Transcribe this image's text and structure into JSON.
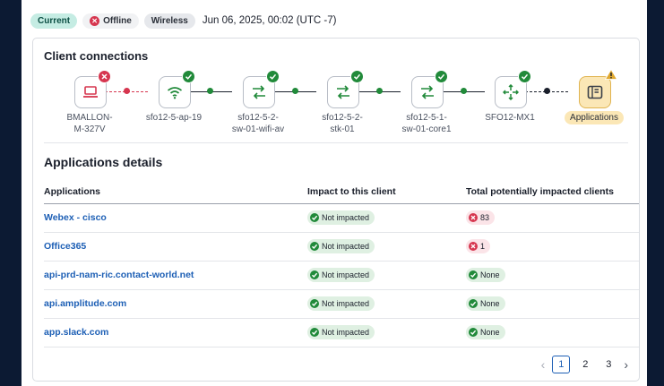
{
  "status": {
    "current_label": "Current",
    "offline_label": "Offline",
    "wireless_label": "Wireless",
    "timestamp": "Jun 06, 2025, 00:02 (UTC -7)"
  },
  "client_connections": {
    "title": "Client connections",
    "nodes": [
      {
        "label_line1": "BMALLON-",
        "label_line2": "M-327V",
        "icon": "laptop-icon",
        "status": "error"
      },
      {
        "label_line1": "sfo12-5-ap-19",
        "label_line2": "",
        "icon": "wifi-icon",
        "status": "ok"
      },
      {
        "label_line1": "sfo12-5-2-",
        "label_line2": "sw-01-wifi-av",
        "icon": "switch-icon",
        "status": "ok"
      },
      {
        "label_line1": "sfo12-5-2-",
        "label_line2": "stk-01",
        "icon": "switch-icon",
        "status": "ok"
      },
      {
        "label_line1": "sfo12-5-1-",
        "label_line2": "sw-01-core1",
        "icon": "switch-icon",
        "status": "ok"
      },
      {
        "label_line1": "SFO12-MX1",
        "label_line2": "",
        "icon": "router-icon",
        "status": "ok"
      },
      {
        "label_line1": "Applications",
        "label_line2": "",
        "icon": "applications-icon",
        "status": "warning"
      }
    ]
  },
  "applications_details": {
    "title": "Applications details",
    "columns": [
      "Applications",
      "Impact to this client",
      "Total potentially impacted clients"
    ],
    "rows": [
      {
        "app": "Webex - cisco",
        "impact": "Not impacted",
        "total": "83",
        "total_status": "error"
      },
      {
        "app": "Office365",
        "impact": "Not impacted",
        "total": "1",
        "total_status": "error"
      },
      {
        "app": "api-prd-nam-ric.contact-world.net",
        "impact": "Not impacted",
        "total": "None",
        "total_status": "ok"
      },
      {
        "app": "api.amplitude.com",
        "impact": "Not impacted",
        "total": "None",
        "total_status": "ok"
      },
      {
        "app": "app.slack.com",
        "impact": "Not impacted",
        "total": "None",
        "total_status": "ok"
      }
    ]
  },
  "pagination": {
    "pages": [
      "1",
      "2",
      "3"
    ],
    "current": "1",
    "prev_icon": "chevron-left-icon",
    "next_icon": "chevron-right-icon"
  },
  "colors": {
    "ok": "#218a3a",
    "error": "#d6364f",
    "warning": "#e0a82e",
    "link": "#1d5fb5",
    "current_pill": "#c5ece3"
  }
}
